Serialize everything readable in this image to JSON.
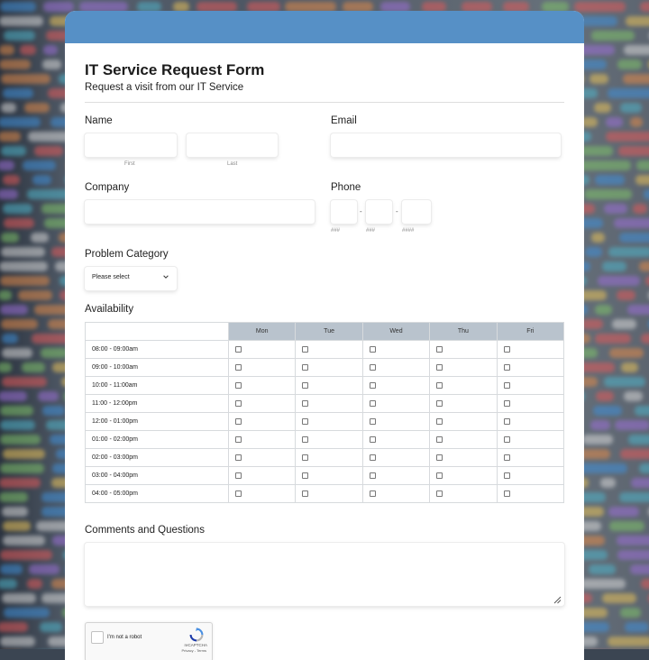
{
  "form": {
    "title": "IT Service Request Form",
    "subtitle": "Request a visit from our IT Service",
    "accent_color": "#5690c6"
  },
  "fields": {
    "name_label": "Name",
    "first_sub": "First",
    "last_sub": "Last",
    "email_label": "Email",
    "company_label": "Company",
    "phone_label": "Phone",
    "phone_sub_area": "###",
    "phone_sub_prefix": "###",
    "phone_sub_line": "####",
    "phone_sep": "-",
    "category_label": "Problem Category",
    "category_selected": "Please select",
    "availability_label": "Availability",
    "comments_label": "Comments and Questions"
  },
  "availability": {
    "days": [
      "Mon",
      "Tue",
      "Wed",
      "Thu",
      "Fri"
    ],
    "slots": [
      "08:00 - 09:00am",
      "09:00 - 10:00am",
      "10:00 - 11:00am",
      "11:00 - 12:00pm",
      "12:00 - 01:00pm",
      "01:00 - 02:00pm",
      "02:00 - 03:00pm",
      "03:00 - 04:00pm",
      "04:00 - 05:00pm"
    ]
  },
  "captcha": {
    "label": "I'm not a robot",
    "brand": "reCAPTCHA",
    "links": "Privacy - Terms"
  }
}
